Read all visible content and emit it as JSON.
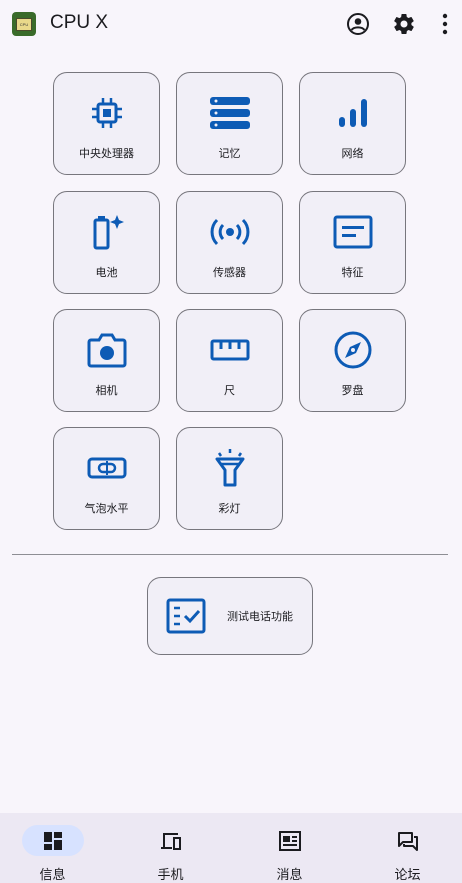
{
  "app": {
    "title": "CPU X",
    "logo_text": "CPU",
    "accent": "#0d5bb5"
  },
  "appbar": {
    "icons": [
      "account-circle-icon",
      "settings-gear-icon",
      "more-vert-icon"
    ]
  },
  "tools": [
    {
      "label": "中央处理器",
      "icon": "cpu-chip-icon"
    },
    {
      "label": "记忆",
      "icon": "memory-storage-icon"
    },
    {
      "label": "网络",
      "icon": "signal-bars-icon"
    },
    {
      "label": "电池",
      "icon": "battery-icon"
    },
    {
      "label": "传感器",
      "icon": "sensor-waves-icon"
    },
    {
      "label": "特征",
      "icon": "feature-card-icon"
    },
    {
      "label": "相机",
      "icon": "camera-icon"
    },
    {
      "label": "尺",
      "icon": "ruler-icon"
    },
    {
      "label": "罗盘",
      "icon": "compass-icon"
    },
    {
      "label": "气泡水平",
      "icon": "bubble-level-icon"
    },
    {
      "label": "彩灯",
      "icon": "flashlight-icon"
    }
  ],
  "test_button": {
    "label": "测试电话功能",
    "icon": "checklist-icon"
  },
  "bottom_nav": [
    {
      "label": "信息",
      "icon": "dashboard-icon",
      "active": true
    },
    {
      "label": "手机",
      "icon": "devices-icon",
      "active": false
    },
    {
      "label": "消息",
      "icon": "news-icon",
      "active": false
    },
    {
      "label": "论坛",
      "icon": "forum-icon",
      "active": false
    }
  ]
}
